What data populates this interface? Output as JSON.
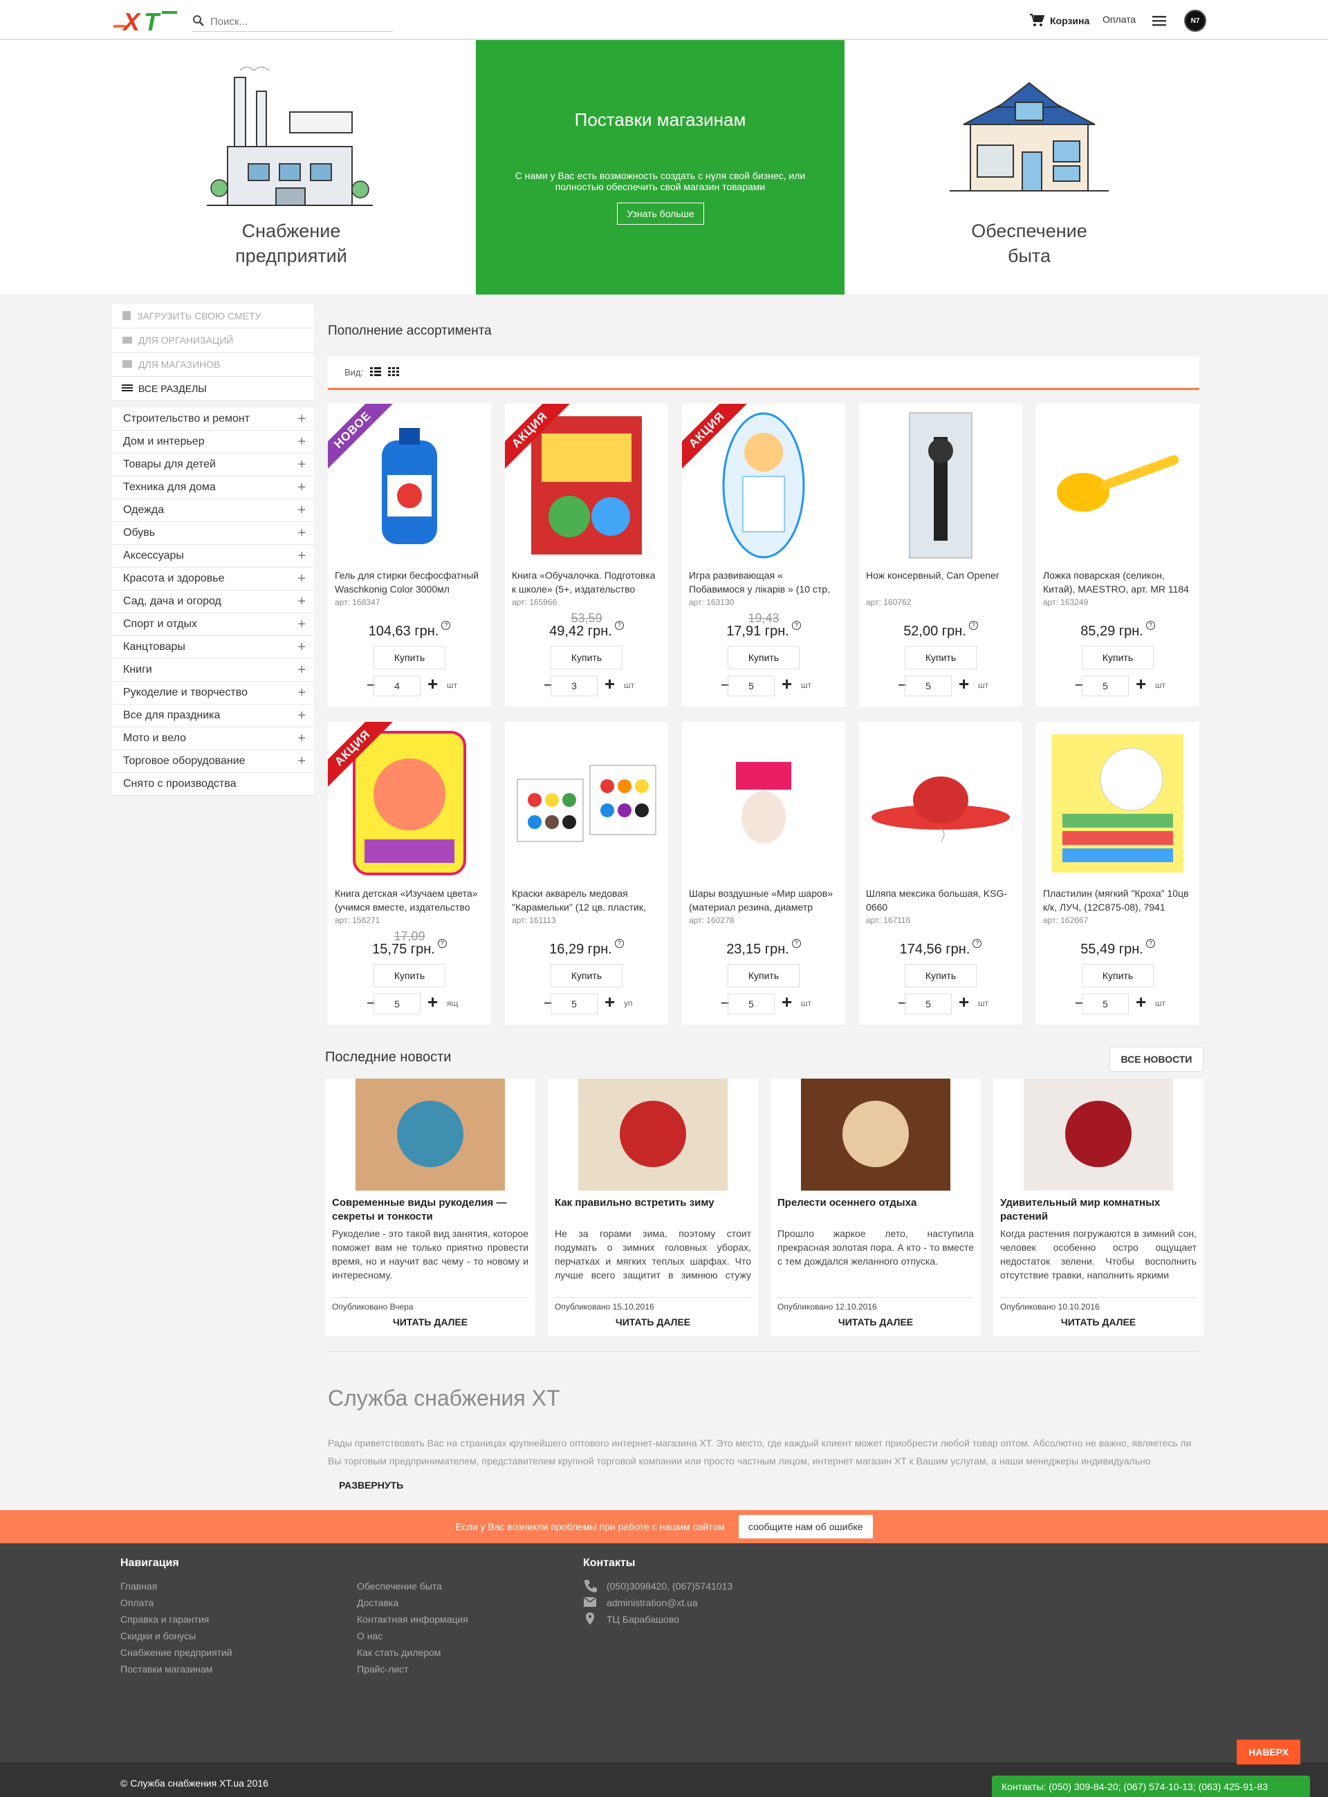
{
  "header": {
    "search_placeholder": "Поиск...",
    "cart_label": "Корзина",
    "pay_label": "Оплата",
    "logo_text": "XT",
    "avatar_text": "N7"
  },
  "hero": {
    "left_title_1": "Снабжение",
    "left_title_2": "предприятий",
    "mid_title": "Поставки магазинам",
    "mid_text": "С нами у Вас есть возможность создать с нуля свой бизнес, или полностью обеспечить свой магазин товарами",
    "mid_button": "Узнать больше",
    "right_title_1": "Обеспечение",
    "right_title_2": "быта"
  },
  "sidebar": {
    "top_links": [
      "Загрузить свою смету",
      "Для организаций",
      "Для магазинов"
    ],
    "all_sections": "Все разделы",
    "categories": [
      "Строительство и ремонт",
      "Дом и интерьер",
      "Товары для детей",
      "Техника для дома",
      "Одежда",
      "Обувь",
      "Аксессуары",
      "Красота и здоровье",
      "Сад, дача и огород",
      "Спорт и отдых",
      "Канцтовары",
      "Книги",
      "Рукоделие и творчество",
      "Все для праздника",
      "Мото и вело",
      "Торговое оборудование",
      "Снято с производства"
    ]
  },
  "products": {
    "section_title": "Пополнение ассортимента",
    "view_label": "Вид:",
    "buy_label": "Купить",
    "items": [
      {
        "name": "Гель для стирки бесфосфатный Waschkonig Color 3000мл",
        "art": "арт: 168347",
        "old": "",
        "price": "104,63 грн.",
        "qty": "4",
        "unit": "шт",
        "badge": "НОВОЕ"
      },
      {
        "name": "Книга «Обучалочка. Подготовка к школе» (5+, издательство",
        "art": "арт: 165966",
        "old": "53,59",
        "price": "49,42 грн.",
        "qty": "3",
        "unit": "шт",
        "badge": "АКЦИЯ"
      },
      {
        "name": "Игра развивающая « Побавимося у лікарів » (10 стр,",
        "art": "арт: 163130",
        "old": "19,43",
        "price": "17,91 грн.",
        "qty": "5",
        "unit": "шт",
        "badge": "АКЦИЯ"
      },
      {
        "name": "Нож консервный, Can Opener",
        "art": "арт: 160762",
        "old": "",
        "price": "52,00 грн.",
        "qty": "5",
        "unit": "шт",
        "badge": ""
      },
      {
        "name": "Ложка поварская (селикон, Китай), MAESTRO, арт. MR 1184",
        "art": "арт: 163249",
        "old": "",
        "price": "85,29 грн.",
        "qty": "5",
        "unit": "шт",
        "badge": ""
      },
      {
        "name": "Книга детская «Изучаем цвета» (учимся вместе, издательство",
        "art": "арт: 156271",
        "old": "17,09",
        "price": "15,75 грн.",
        "qty": "5",
        "unit": "ящ",
        "badge": "АКЦИЯ"
      },
      {
        "name": "Краски акварель медовая \"Карамельки\" (12 цв. пластик,",
        "art": "арт: 161113",
        "old": "",
        "price": "16,29 грн.",
        "qty": "5",
        "unit": "уп",
        "badge": ""
      },
      {
        "name": "Шары воздушные «Мир шаров» (материал резина, диаметр",
        "art": "арт: 160278",
        "old": "",
        "price": "23,15 грн.",
        "qty": "5",
        "unit": "шт",
        "badge": ""
      },
      {
        "name": "Шляпа мексика большая, KSG-0660",
        "art": "арт: 167116",
        "old": "",
        "price": "174,56 грн.",
        "qty": "5",
        "unit": "шт",
        "badge": ""
      },
      {
        "name": "Пластилин (мягкий \"Кроха\" 10цв к/к, ЛУЧ, (12С875-08), 7941",
        "art": "арт: 162667",
        "old": "",
        "price": "55,49 грн.",
        "qty": "5",
        "unit": "шт",
        "badge": ""
      }
    ]
  },
  "news": {
    "title": "Последние новости",
    "all_button": "Все новости",
    "more_label": "Читать далее",
    "items": [
      {
        "title": "Современные виды рукоделия — секреты и тонкости",
        "text": "Рукоделие - это такой вид занятия, которое поможет вам не только приятно провести время, но и научит вас чему - то новому и интересному.",
        "date": "Опубликовано Вчера"
      },
      {
        "title": "Как правильно встретить зиму",
        "text": "Не за горами зима, поэтому стоит подумать о зимних головных уборах, перчатках и мягких теплых шарфах. Что лучше всего защитит в зимнюю стужу открытые участки тела, сбережет",
        "date": "Опубликовано 15.10.2016"
      },
      {
        "title": "Прелести осеннего отдыха",
        "text": "Прошло жаркое лето, наступила прекрасная золотая пора. А кто - то вместе с тем дождался желанного отпуска.",
        "date": "Опубликовано 12.10.2016"
      },
      {
        "title": "Удивительный мир комнатных растений",
        "text": "Когда растения погружаются в зимний сон, человек особенно остро ощущает недостаток зелени. Чтобы восполнить отсутствие травки, наполнить яркими",
        "date": "Опубликовано 10.10.2016"
      }
    ]
  },
  "about": {
    "title": "Служба снабжения XT",
    "text": "Рады приветствовать Вас на страницах крупнейшего оптового интернет-магазина XT. Это место, где каждый клиент может приобрести любой товар оптом. Абсолютно не важно, являетесь ли Вы торговым предпринимателем, представителем крупной торговой компании или просто частным лицом, интернет магазин XT к Вашим услугам, а наши менеджеры индивидуально",
    "expand": "Развернуть"
  },
  "feedback": {
    "text": "Если у Вас возникли проблемы при работе с нашим сайтом",
    "button": "сообщите нам об ошибке"
  },
  "footer": {
    "nav_title": "Навигация",
    "nav_col1": [
      "Главная",
      "Оплата",
      "Справка и гарантия",
      "Скидки и бонусы",
      "Снабжение предприятий",
      "Поставки магазинам"
    ],
    "nav_col2": [
      "Обеспечение быта",
      "Доставка",
      "Контактная информация",
      "О нас",
      "Как стать дилером",
      "Прайс-лист"
    ],
    "contacts_title": "Контакты",
    "phone": "(050)3098420, (067)5741013",
    "email": "administration@xt.ua",
    "address": "ТЦ Барабашово",
    "copyright": "© Служба снабжения XT.ua 2016",
    "to_top": "Наверх",
    "contacts_bar": "Контакты: (050) 309-84-20; (067) 574-10-13; (063) 425-91-83"
  },
  "colors": {
    "accent": "#ff7a45",
    "green": "#2ca635",
    "sale": "#d7191f",
    "new": "#8e3fb0",
    "footer": "#444343"
  }
}
